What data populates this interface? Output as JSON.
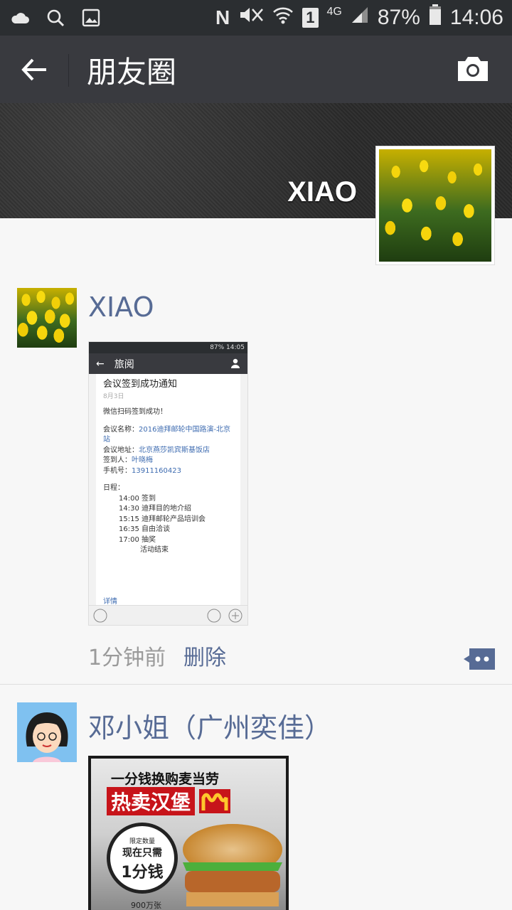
{
  "status_bar": {
    "battery": "87%",
    "time": "14:06",
    "network": "4G",
    "sim": "1",
    "nfc": "N"
  },
  "header": {
    "title": "朋友圈",
    "back_icon": "arrow-left-icon",
    "camera_icon": "camera-icon"
  },
  "cover": {
    "name": "XIAO"
  },
  "posts": [
    {
      "user": "XIAO",
      "time": "1分钟前",
      "delete": "删除",
      "screenshot": {
        "status": "87%  14:05",
        "title": "旅阅",
        "heading": "会议签到成功通知",
        "date": "8月3日",
        "success": "微信扫码签到成功！",
        "name_label": "会议名称：",
        "name_value": "2016迪拜邮轮中国路演-北京站",
        "addr_label": "会议地址：",
        "addr_value": "北京燕莎凯宾斯基饭店",
        "signer_label": "签到人：",
        "signer_value": "叶晓梅",
        "phone_label": "手机号：",
        "phone_value": "13911160423",
        "schedule_label": "日程：",
        "schedule": [
          "14:00 签到",
          "14:30 迪拜目的地介绍",
          "15:15 迪拜邮轮产品培训会",
          "16:35 自由洽谈",
          "17:00 抽奖"
        ],
        "end": "活动结束",
        "more": "详情"
      }
    },
    {
      "user": "邓小姐（广州奕佳）",
      "ad_line1": "一分钱换购麦当劳",
      "ad_line2": "热卖汉堡",
      "ad_badge_top": "限定数量",
      "ad_badge_mid": "现在只需",
      "ad_badge_price": "1分钱",
      "ad_bottom": "900万张"
    }
  ],
  "colors": {
    "link": "#576b95",
    "titlebar": "#393a3f",
    "statusbar": "#2b2e31"
  }
}
